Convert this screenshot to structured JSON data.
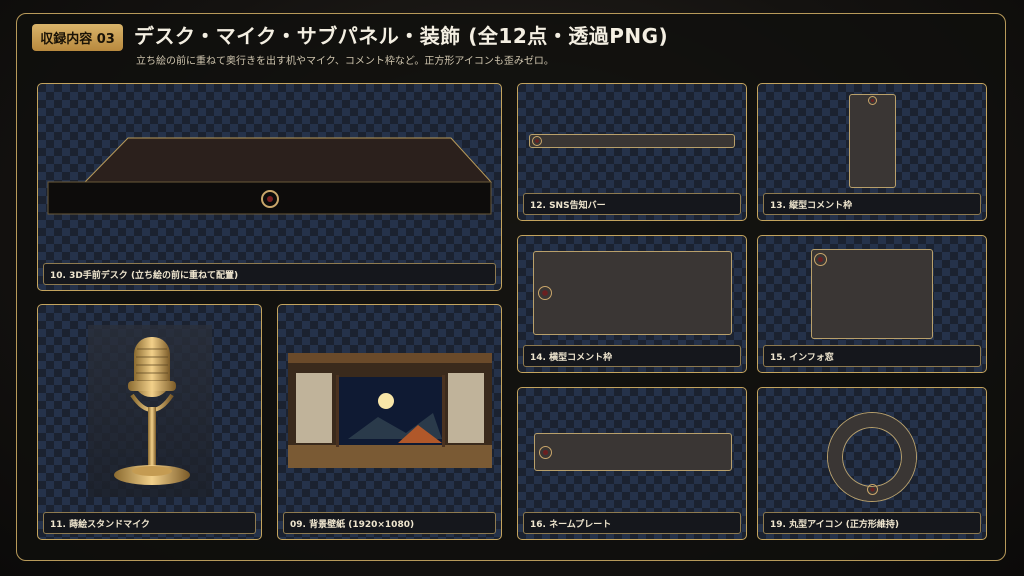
{
  "header": {
    "badge": "収録内容 03",
    "title": "デスク・マイク・サブパネル・装飾 (全12点・透過PNG)",
    "subtitle": "立ち絵の前に重ねて奥行きを出す机やマイク、コメント枠など。正方形アイコンも歪みゼロ。"
  },
  "cards": [
    {
      "id": "desk",
      "caption": "10. 3D手前デスク (立ち絵の前に重ねて配置)"
    },
    {
      "id": "sns",
      "caption": "12. SNS告知バー"
    },
    {
      "id": "vcomment",
      "caption": "13. 縦型コメント枠"
    },
    {
      "id": "hcomment",
      "caption": "14. 横型コメント枠"
    },
    {
      "id": "info",
      "caption": "15. インフォ窓"
    },
    {
      "id": "mic",
      "caption": "11. 蒔絵スタンドマイク"
    },
    {
      "id": "bg",
      "caption": "09. 背景壁紙 (1920×1080)"
    },
    {
      "id": "nameplate",
      "caption": "16. ネームプレート"
    },
    {
      "id": "round",
      "caption": "19. 丸型アイコン (正方形維持)"
    }
  ],
  "colors": {
    "accent_gold": "#c4a45e",
    "card_bg": "#1b2230"
  }
}
